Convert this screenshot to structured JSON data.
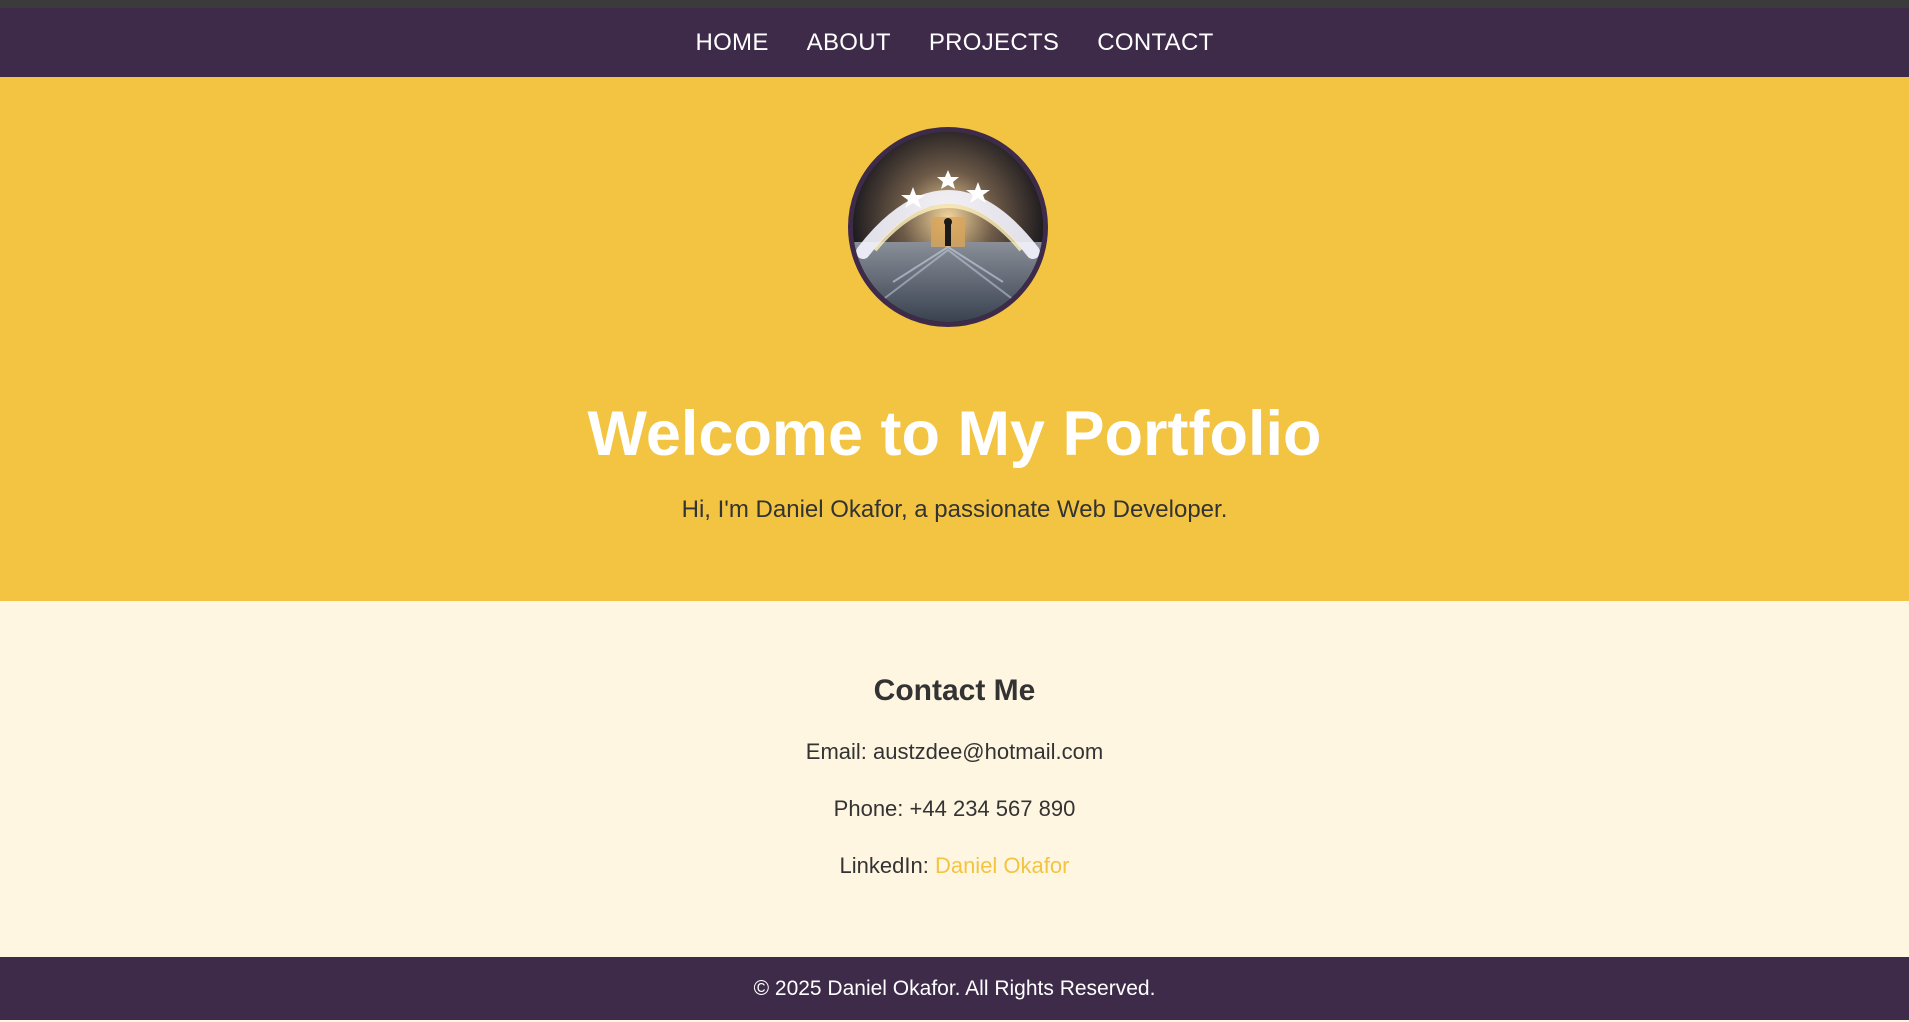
{
  "nav": {
    "items": [
      {
        "label": "HOME"
      },
      {
        "label": "ABOUT"
      },
      {
        "label": "PROJECTS"
      },
      {
        "label": "CONTACT"
      }
    ]
  },
  "hero": {
    "title": "Welcome to My Portfolio",
    "subtitle": "Hi, I'm Daniel Okafor, a passionate Web Developer."
  },
  "contact": {
    "heading": "Contact Me",
    "email_label": "Email:",
    "email": "austzdee@hotmail.com",
    "phone_label": "Phone:",
    "phone": "+44 234 567 890",
    "linkedin_label": "LinkedIn:",
    "linkedin": "Daniel Okafor"
  },
  "footer": {
    "text": "© 2025 Daniel Okafor. All Rights Reserved."
  },
  "colors": {
    "nav_bg": "#3e2a49",
    "hero_bg": "#f3c441",
    "page_bg": "#fef6e1",
    "link": "#f3c441",
    "text": "#333333"
  }
}
